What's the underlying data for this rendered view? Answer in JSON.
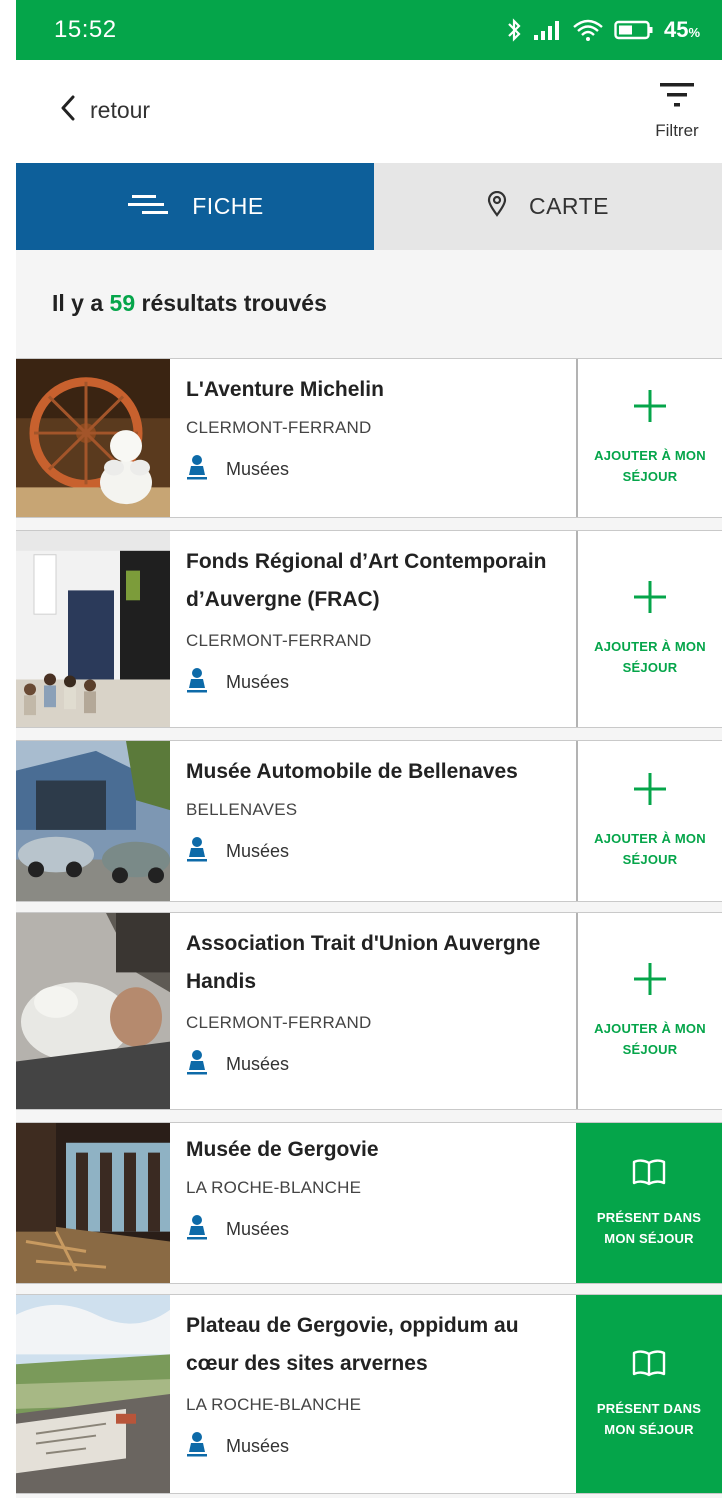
{
  "status_bar": {
    "time": "15:52",
    "battery": "45",
    "battery_unit": "%",
    "icons": [
      "bluetooth-icon",
      "signal-icon",
      "wifi-icon",
      "battery-icon"
    ]
  },
  "header": {
    "back_label": "retour",
    "filter_label": "Filtrer"
  },
  "tabs": [
    {
      "label": "FICHE",
      "icon": "list-icon",
      "active": true
    },
    {
      "label": "CARTE",
      "icon": "map-pin-icon",
      "active": false
    }
  ],
  "results": {
    "prefix": "Il y a",
    "count": "59",
    "suffix": "résultats trouvés"
  },
  "items": [
    {
      "title_lines": [
        "L'Aventure Michelin"
      ],
      "city": "CLERMONT-FERRAND",
      "category": "Musées",
      "action": {
        "type": "add",
        "label_lines": [
          "AJOUTER À MON",
          "SÉJOUR"
        ],
        "icon": "plus-icon"
      }
    },
    {
      "title_lines": [
        "Fonds Régional d’Art Contemporain",
        "d’Auvergne (FRAC)"
      ],
      "city": "CLERMONT-FERRAND",
      "category": "Musées",
      "action": {
        "type": "add",
        "label_lines": [
          "AJOUTER À MON",
          "SÉJOUR"
        ],
        "icon": "plus-icon"
      }
    },
    {
      "title_lines": [
        "Musée Automobile de Bellenaves"
      ],
      "city": "BELLENAVES",
      "category": "Musées",
      "action": {
        "type": "add",
        "label_lines": [
          "AJOUTER À MON",
          "SÉJOUR"
        ],
        "icon": "plus-icon"
      }
    },
    {
      "title_lines": [
        "Association Trait d'Union Auvergne",
        "Handis"
      ],
      "city": "CLERMONT-FERRAND",
      "category": "Musées",
      "action": {
        "type": "add",
        "label_lines": [
          "AJOUTER À MON",
          "SÉJOUR"
        ],
        "icon": "plus-icon"
      }
    },
    {
      "title_lines": [
        "Musée de Gergovie"
      ],
      "city": "LA ROCHE-BLANCHE",
      "category": "Musées",
      "action": {
        "type": "present",
        "label_lines": [
          "PRÉSENT DANS",
          "MON SÉJOUR"
        ],
        "icon": "book-icon"
      }
    },
    {
      "title_lines": [
        "Plateau de Gergovie, oppidum au",
        "cœur des sites arvernes"
      ],
      "city": "LA ROCHE-BLANCHE",
      "category": "Musées",
      "action": {
        "type": "present",
        "label_lines": [
          "PRÉSENT DANS",
          "MON SÉJOUR"
        ],
        "icon": "book-icon"
      }
    }
  ],
  "colors": {
    "green": "#05a54a",
    "blue": "#0d5f9a",
    "category_icon_blue": "#0d6aa8"
  }
}
